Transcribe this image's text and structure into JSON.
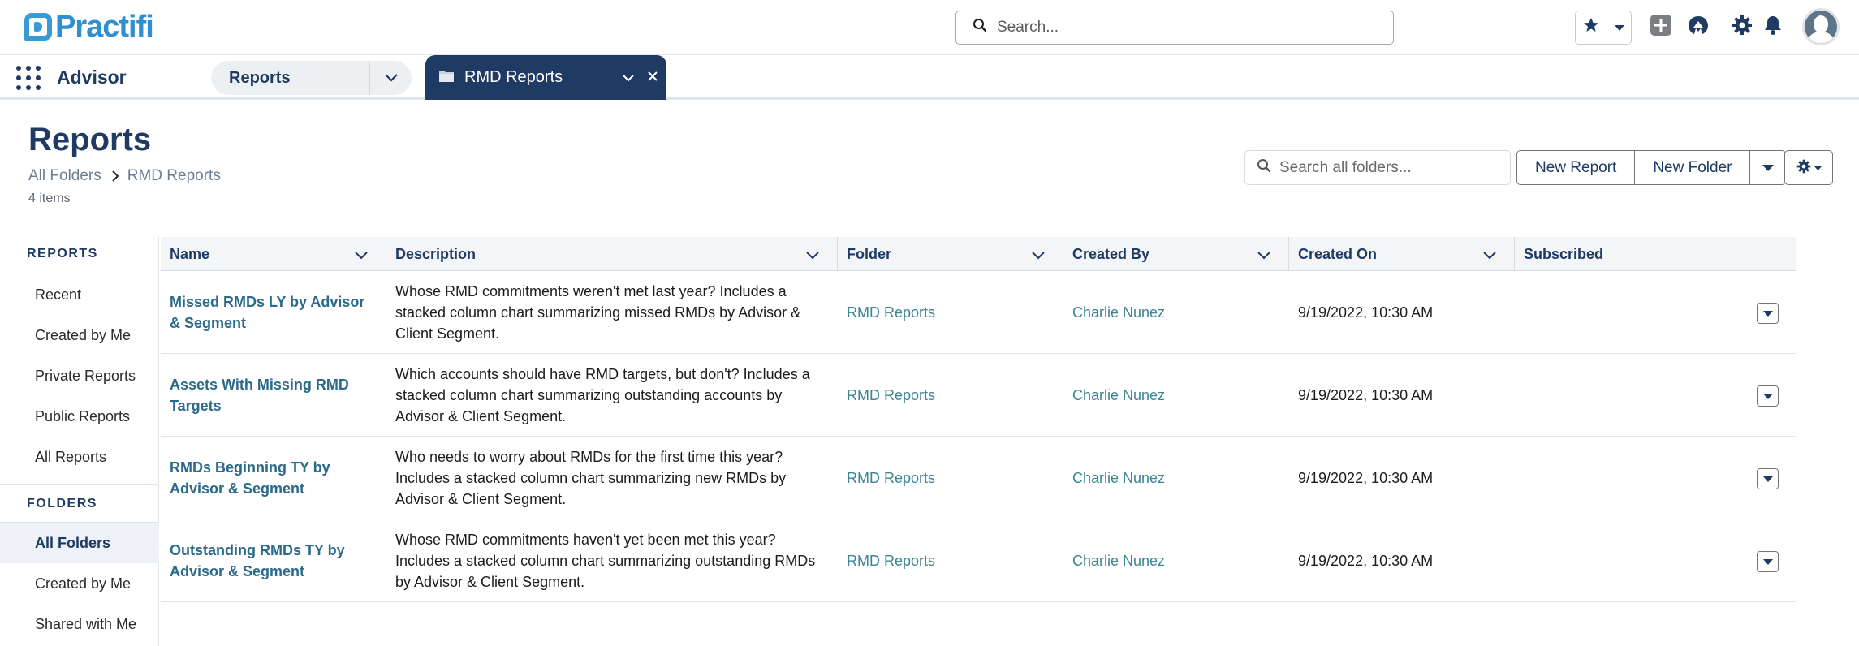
{
  "header": {
    "logo_text": "Practifi",
    "search_placeholder": "Search..."
  },
  "nav": {
    "app_name": "Advisor",
    "nav_item_label": "Reports",
    "active_tab_label": "RMD Reports"
  },
  "page": {
    "title": "Reports",
    "breadcrumb": [
      "All Folders",
      "RMD Reports"
    ],
    "item_count": "4 items",
    "folder_search_placeholder": "Search all folders...",
    "new_report_label": "New Report",
    "new_folder_label": "New Folder"
  },
  "sidebar": {
    "reports_heading": "REPORTS",
    "report_items": [
      "Recent",
      "Created by Me",
      "Private Reports",
      "Public Reports",
      "All Reports"
    ],
    "folders_heading": "FOLDERS",
    "folder_items": [
      "All Folders",
      "Created by Me",
      "Shared with Me"
    ],
    "selected_folder": "All Folders"
  },
  "table": {
    "columns": [
      "Name",
      "Description",
      "Folder",
      "Created By",
      "Created On",
      "Subscribed"
    ],
    "rows": [
      {
        "name": "Missed RMDs LY by Advisor & Segment",
        "description": "Whose RMD commitments weren't met last year? Includes a stacked column chart summarizing missed RMDs by Advisor & Client Segment.",
        "folder": "RMD Reports",
        "created_by": "Charlie Nunez",
        "created_on": "9/19/2022, 10:30 AM",
        "subscribed": ""
      },
      {
        "name": "Assets With Missing RMD Targets",
        "description": "Which accounts should have RMD targets, but don't? Includes a stacked column chart summarizing outstanding accounts by Advisor & Client Segment.",
        "folder": "RMD Reports",
        "created_by": "Charlie Nunez",
        "created_on": "9/19/2022, 10:30 AM",
        "subscribed": ""
      },
      {
        "name": "RMDs Beginning TY by Advisor & Segment",
        "description": "Who needs to worry about RMDs for the first time this year? Includes a stacked column chart summarizing new RMDs by Advisor & Client Segment.",
        "folder": "RMD Reports",
        "created_by": "Charlie Nunez",
        "created_on": "9/19/2022, 10:30 AM",
        "subscribed": ""
      },
      {
        "name": "Outstanding RMDs TY by Advisor & Segment",
        "description": "Whose RMD commitments haven't yet been met this year? Includes a stacked column chart summarizing outstanding RMDs by Advisor & Client Segment.",
        "folder": "RMD Reports",
        "created_by": "Charlie Nunez",
        "created_on": "9/19/2022, 10:30 AM",
        "subscribed": ""
      }
    ]
  },
  "colors": {
    "brand_navy": "#1f3b64",
    "logo_blue": "#2f8fd0",
    "link_teal": "#3d8494"
  },
  "icons": {
    "search": "search-icon",
    "favorite": "star-icon",
    "favorites_menu": "chevron-down-icon",
    "global_actions": "plus-square-icon",
    "help": "trailhead-icon",
    "setup": "gear-icon",
    "notifications": "bell-icon",
    "app_launcher": "waffle-icon",
    "folder": "folder-icon",
    "close": "close-icon",
    "breadcrumb_separator": "chevron-right-icon",
    "row_actions": "caret-down-icon"
  }
}
